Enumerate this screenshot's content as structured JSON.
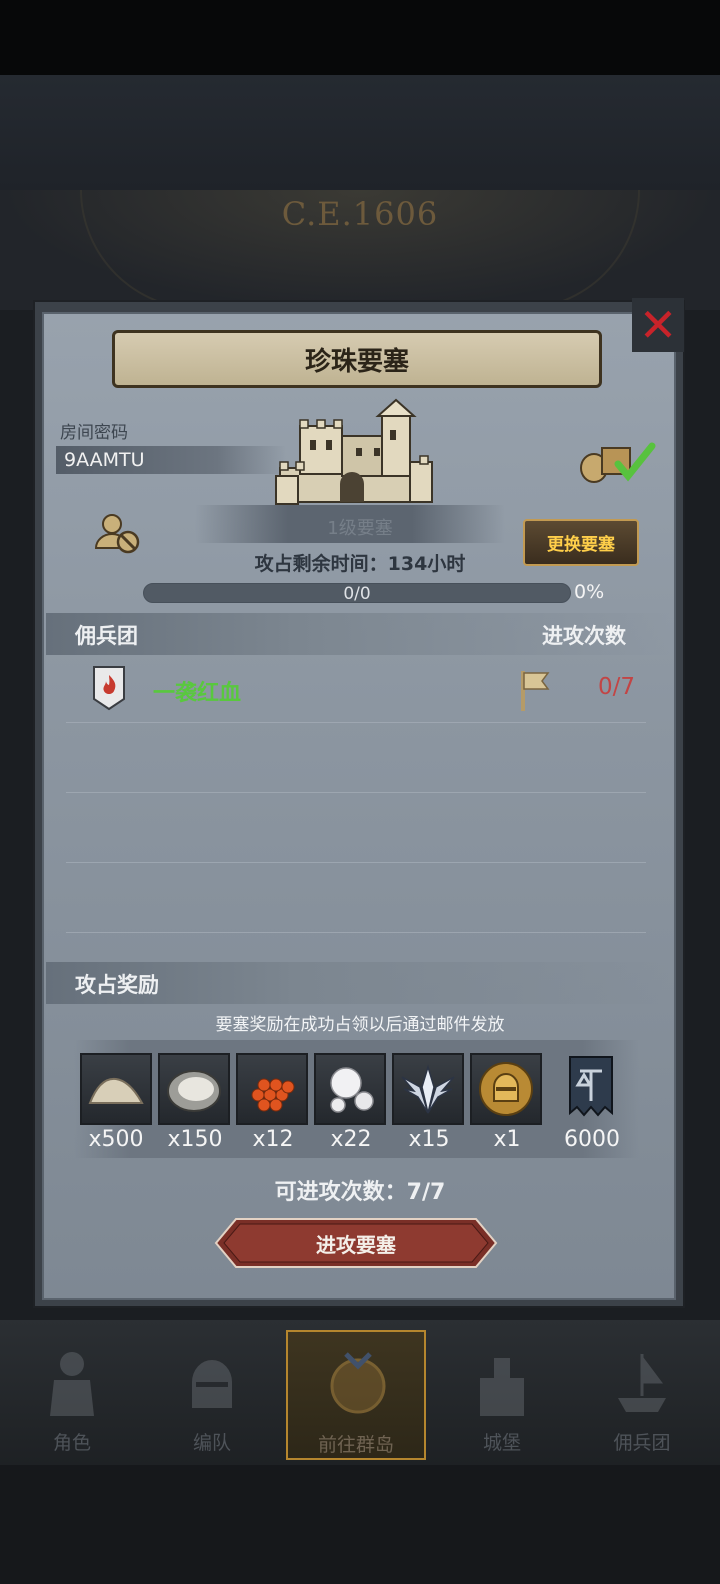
{
  "background": {
    "era_text": "C.E.1606"
  },
  "dialog": {
    "title": "珍珠要塞",
    "close_icon": "close-x-icon",
    "room_password_label": "房间密码",
    "room_password": "9AAMTU",
    "fort_level_text": "1级要塞",
    "change_fort_label": "更换要塞",
    "remaining_time_label": "攻占剩余时间：",
    "remaining_time_value": "134小时",
    "progress": {
      "text": "0/0",
      "percent_text": "0%",
      "fraction": 0
    },
    "mercenary": {
      "section_title": "佣兵团",
      "attack_count_header": "进攻次数",
      "rows": [
        {
          "name": "一袭红血",
          "attacks": "0/7"
        }
      ]
    },
    "rewards": {
      "section_title": "攻占奖励",
      "note": "要塞奖励在成功占领以后通过邮件发放",
      "items": [
        {
          "icon": "sand-pile-icon",
          "qty": "x500"
        },
        {
          "icon": "oyster-icon",
          "qty": "x150"
        },
        {
          "icon": "red-roe-icon",
          "qty": "x12"
        },
        {
          "icon": "pearls-icon",
          "qty": "x22"
        },
        {
          "icon": "winged-emblem-icon",
          "qty": "x15"
        },
        {
          "icon": "knight-helmet-icon",
          "qty": "x1"
        },
        {
          "icon": "guild-banner-icon",
          "qty": "6000"
        }
      ]
    },
    "attacks_available_label": "可进攻次数：",
    "attacks_available_value": "7/7",
    "attack_button_label": "进攻要塞"
  },
  "nav": {
    "items": [
      {
        "label": "角色",
        "icon": "knight-icon"
      },
      {
        "label": "编队",
        "icon": "helmet-icon"
      },
      {
        "label": "前往群岛",
        "icon": "compass-icon",
        "active": true
      },
      {
        "label": "城堡",
        "icon": "castle-icon"
      },
      {
        "label": "佣兵团",
        "icon": "ship-icon"
      }
    ]
  },
  "colors": {
    "accent_gold": "#ffcf4a",
    "guild_green": "#59c83e",
    "count_red": "#c24545",
    "close_red": "#c8232a"
  }
}
